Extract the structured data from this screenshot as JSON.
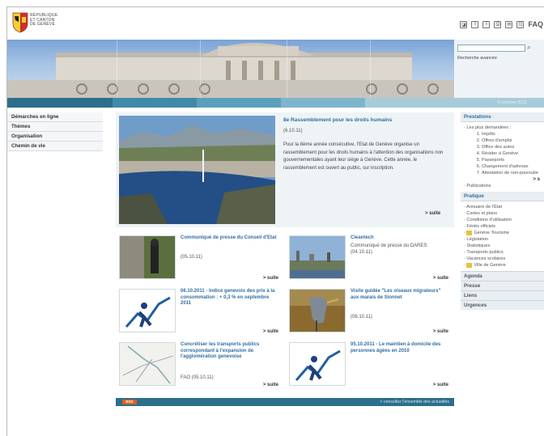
{
  "header": {
    "logo_lines": [
      "RÉPUBLIQUE",
      "ET CANTON",
      "DE GENÈVE"
    ],
    "faq": "FAQ"
  },
  "search": {
    "advanced": "Recherche avancée"
  },
  "date": "6 octobre 2011",
  "left_nav": [
    "Démarches en ligne",
    "Thèmes",
    "Organisation",
    "Chemin de vie"
  ],
  "hero": {
    "title": "8e Rassemblement pour les droits humains",
    "date": "(6.10.11)",
    "text": "Pour la 8ème année consécutive, l'Etat de Genève organise un rassemblement pour les droits humains à l'attention des organisations non gouvernementales ayant leur siège à Genève. Cette année, le rassemblement est ouvert au public, sur inscription.",
    "more": "> suite"
  },
  "news": [
    {
      "title": "Communiqué de presse du Conseil d'Etat",
      "date": "(05.10.11)",
      "more": "> suite"
    },
    {
      "title": "Cleantech",
      "date": "Communiqué de presse du DARES (04.10.11)",
      "more": "> suite"
    },
    {
      "title": "06.10.2011 - Indice genevois des prix à la consommation : + 0,3 % en septembre 2011",
      "date": "",
      "more": "> suite"
    },
    {
      "title": "Visite guidée \"Les oiseaux migrateurs\" aux marais de Sionnet",
      "date": "(06.10.11)",
      "more": "> suite"
    },
    {
      "title": "Concrétiser les transports publics correspondant à l'expansion de l'agglomération genevoise",
      "date": "FAO (05.10.11)",
      "more": "> suite"
    },
    {
      "title": "05.10.2011 - Le maintien à domicile des personnes âgées en 2010",
      "date": "",
      "more": "> suite"
    }
  ],
  "footer": {
    "rss": "RSS",
    "all_news": "> consultez l'ensemble des actualités"
  },
  "right": {
    "prestations": "Prestations",
    "most_requested": "Les plus demandées :",
    "list": [
      "Impôts",
      "Offres d'emploi",
      "Office des autos",
      "Résider à Genève",
      "Passeports",
      "Changement d'adresse",
      "Attestation de non-poursuite"
    ],
    "more": "> s",
    "publications": "Publications",
    "pratique": "Pratique",
    "pratique_items": [
      "Annuaire de l'État",
      "Cartes et plans",
      "Conditions d'utilisation",
      "Fériés officiels",
      "Genève Tourisme",
      "Législation",
      "Statistiques",
      "Transports publics",
      "Vacances scolaires",
      "Ville de Genève"
    ],
    "sections": [
      "Agenda",
      "Presse",
      "Liens",
      "Urgences"
    ]
  }
}
